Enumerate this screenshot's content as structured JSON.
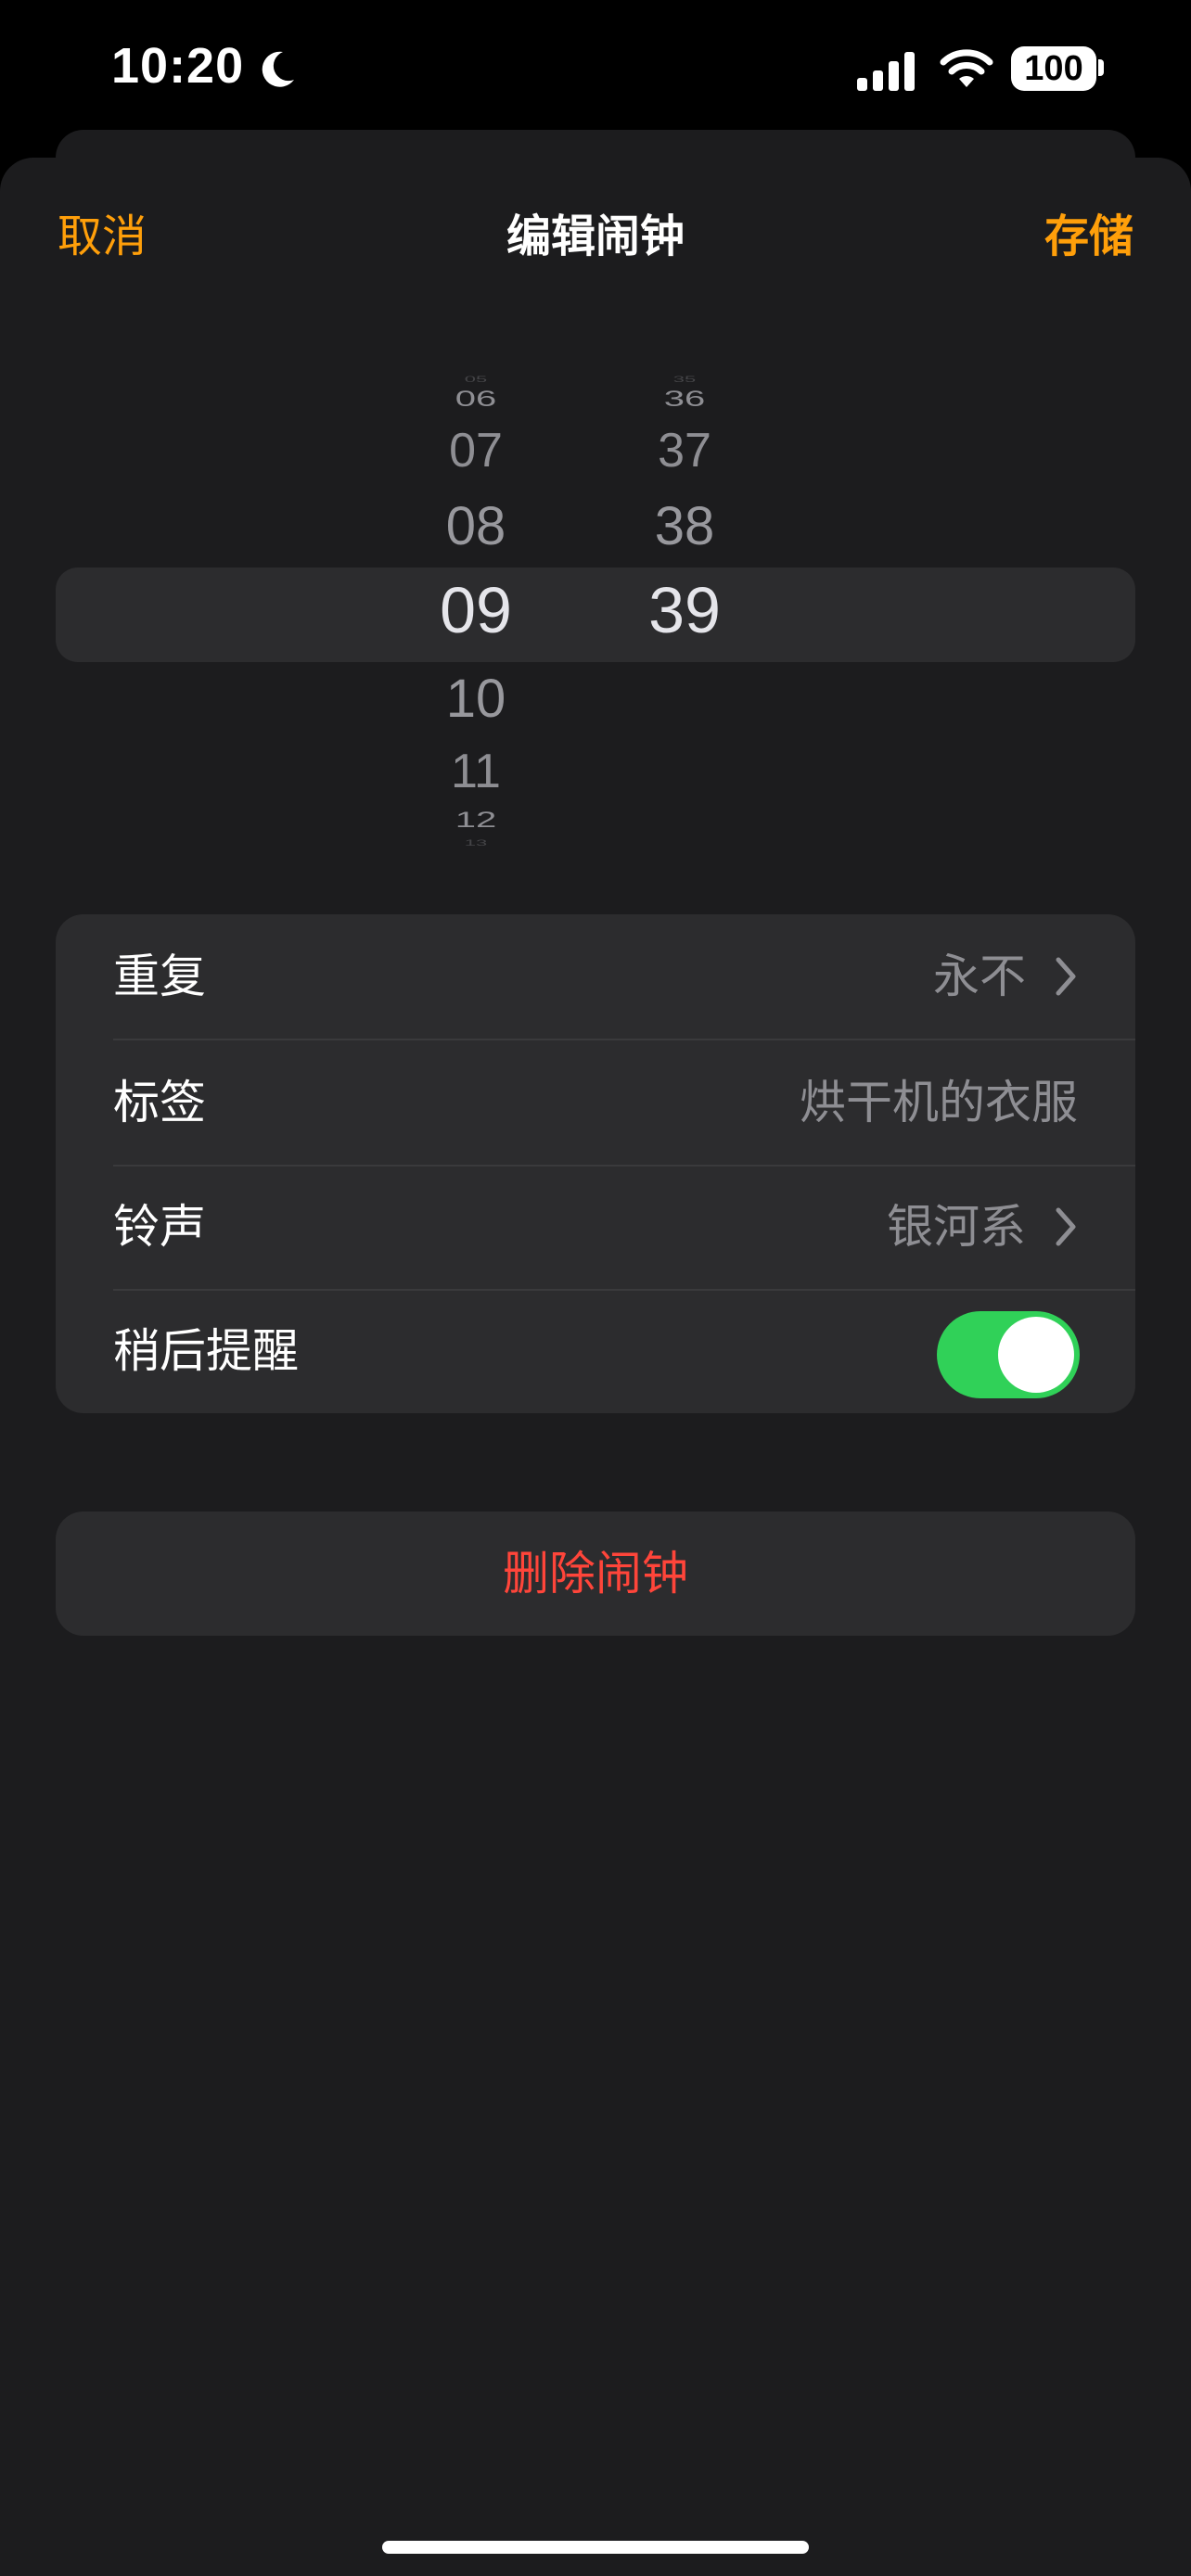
{
  "status_bar": {
    "time": "10:20",
    "battery": "100",
    "icons": [
      "moon-icon",
      "signal-icon",
      "wifi-icon",
      "battery-icon"
    ]
  },
  "nav": {
    "cancel": "取消",
    "title": "编辑闹钟",
    "save": "存储"
  },
  "picker": {
    "hours": [
      "05",
      "06",
      "07",
      "08",
      "09",
      "10",
      "11",
      "12",
      "13"
    ],
    "minutes": [
      "35",
      "36",
      "37",
      "38",
      "39"
    ],
    "selected_hour": "09",
    "selected_minute": "39"
  },
  "settings": {
    "repeat": {
      "label": "重复",
      "value": "永不"
    },
    "label": {
      "label": "标签",
      "value": "烘干机的衣服"
    },
    "sound": {
      "label": "铃声",
      "value": "银河系"
    },
    "snooze": {
      "label": "稍后提醒",
      "enabled": true
    }
  },
  "delete_label": "删除闹钟",
  "colors": {
    "accent": "#ff9f0a",
    "destructive": "#ff453a",
    "toggle_on": "#30d158",
    "sheet_bg": "#1c1c1e",
    "group_bg": "#2c2c2e"
  }
}
